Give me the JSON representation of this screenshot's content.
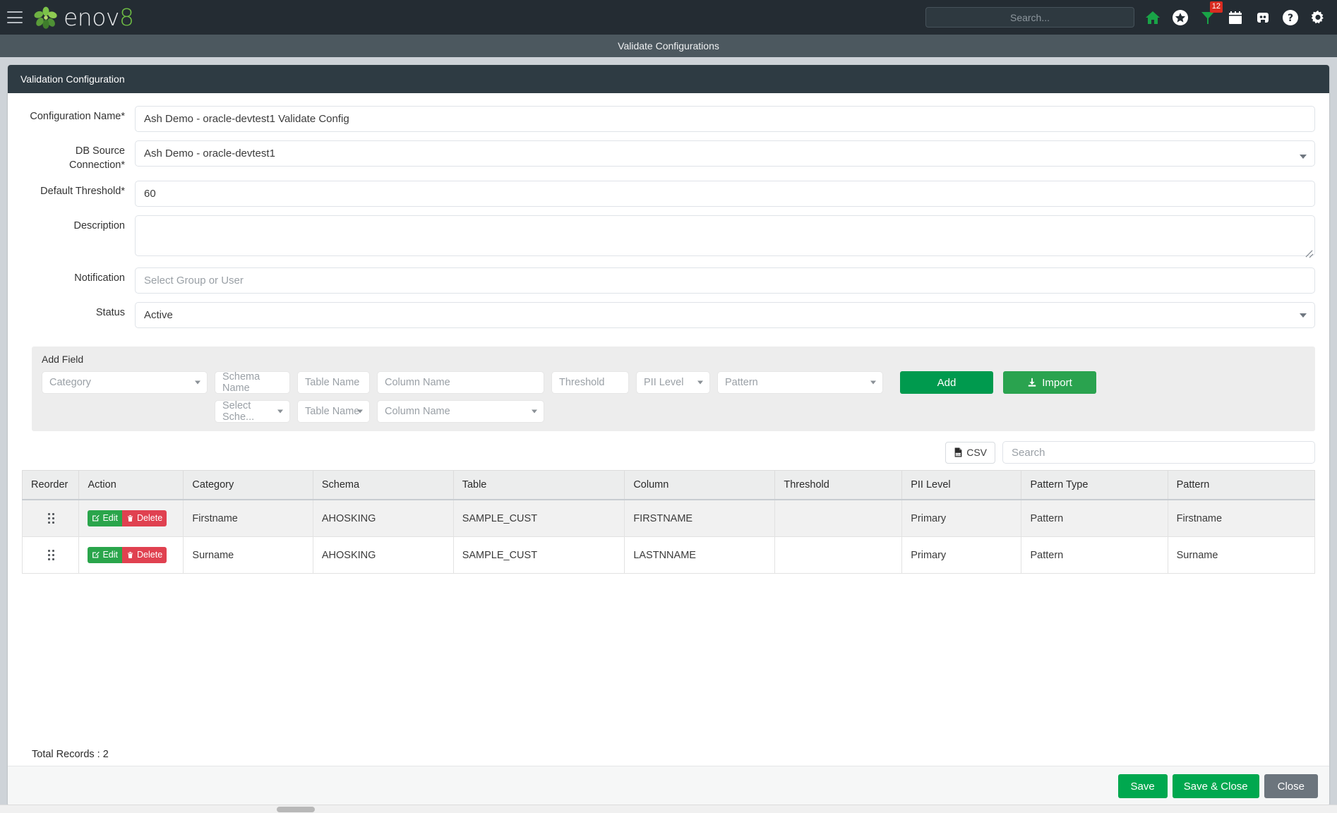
{
  "navbar": {
    "brand": "enov",
    "brand_suffix": "8",
    "menu_icon": "hamburger-icon",
    "search_placeholder": "Search...",
    "search_value": "",
    "icons": [
      {
        "name": "home-icon",
        "label": "Home"
      },
      {
        "name": "star-icon",
        "label": "Favorites"
      },
      {
        "name": "alert-flag-icon",
        "label": "Alerts",
        "badge": "12"
      },
      {
        "name": "calendar-icon",
        "label": "Calendar"
      },
      {
        "name": "robot-icon",
        "label": "Automation"
      },
      {
        "name": "help-icon",
        "label": "Help"
      },
      {
        "name": "gear-icon",
        "label": "Settings"
      }
    ]
  },
  "page": {
    "title": "Validate Configurations",
    "card_title": "Validation Configuration"
  },
  "form": {
    "configuration_name": {
      "label": "Configuration Name*",
      "value": "Ash Demo - oracle-devtest1 Validate Config",
      "placeholder": ""
    },
    "db_source_connection": {
      "label": "DB Source Connection*",
      "value": "Ash Demo - oracle-devtest1"
    },
    "default_threshold": {
      "label": "Default Threshold*",
      "value": "60"
    },
    "description": {
      "label": "Description",
      "value": "",
      "placeholder": ""
    },
    "notification": {
      "label": "Notification",
      "value": "",
      "placeholder": "Select Group or User"
    },
    "status": {
      "label": "Status",
      "value": "Active"
    }
  },
  "add_field": {
    "title": "Add Field",
    "category": {
      "placeholder": "Category",
      "value": ""
    },
    "schema_name": {
      "placeholder": "Schema Name",
      "value": ""
    },
    "table_name": {
      "placeholder": "Table Name",
      "value": ""
    },
    "column_name": {
      "placeholder": "Column Name",
      "value": ""
    },
    "threshold": {
      "placeholder": "Threshold",
      "value": ""
    },
    "pii_level": {
      "placeholder": "PII Level",
      "value": ""
    },
    "pattern": {
      "placeholder": "Pattern",
      "value": ""
    },
    "select_schema": {
      "placeholder": "Select Sche...",
      "value": ""
    },
    "select_table": {
      "placeholder": "Table Name",
      "value": ""
    },
    "select_column": {
      "placeholder": "Column Name",
      "value": ""
    },
    "add_label": "Add",
    "import_label": "Import",
    "import_icon": "download-icon"
  },
  "table_tools": {
    "csv_label": "CSV",
    "csv_icon": "csv-file-icon",
    "search_placeholder": "Search",
    "search_value": ""
  },
  "grid": {
    "columns": [
      "Reorder",
      "Action",
      "Category",
      "Schema",
      "Table",
      "Column",
      "Threshold",
      "PII Level",
      "Pattern Type",
      "Pattern"
    ],
    "row_actions": {
      "edit_label": "Edit",
      "edit_icon": "pencil-square-icon",
      "delete_label": "Delete",
      "delete_icon": "trash-icon",
      "reorder_icon": "drag-handle-icon"
    },
    "rows": [
      {
        "category": "Firstname",
        "schema": "AHOSKING",
        "table": "SAMPLE_CUST",
        "column": "FIRSTNAME",
        "threshold": "",
        "pii_level": "Primary",
        "pattern_type": "Pattern",
        "pattern": "Firstname"
      },
      {
        "category": "Surname",
        "schema": "AHOSKING",
        "table": "SAMPLE_CUST",
        "column": "LASTNNAME",
        "threshold": "",
        "pii_level": "Primary",
        "pattern_type": "Pattern",
        "pattern": "Surname"
      }
    ],
    "total_records": "Total Records : 2"
  },
  "footer": {
    "save_label": "Save",
    "save_close_label": "Save & Close",
    "close_label": "Close"
  },
  "colors": {
    "navbar_bg": "#242c33",
    "titlebar_bg": "#4c585f",
    "card_header_bg": "#2e3b43",
    "brand_green": "#6fbe44",
    "primary_green": "#00a84f",
    "add_green": "#009a4e",
    "import_green": "#2aa34f",
    "edit_green": "#2aa54b",
    "delete_red": "#e04150",
    "close_gray": "#6c757d",
    "badge_red": "#d92b20"
  }
}
